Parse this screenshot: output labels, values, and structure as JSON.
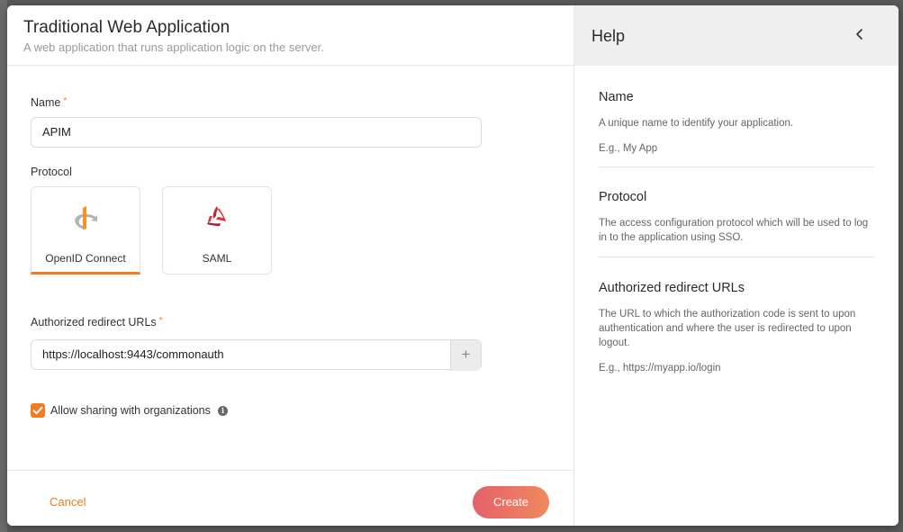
{
  "dialog": {
    "title": "Traditional Web Application",
    "subtitle": "A web application that runs application logic on the server."
  },
  "form": {
    "name_label": "Name",
    "required_marker": "*",
    "name_value": "APIM",
    "protocol_label": "Protocol",
    "protocols": [
      {
        "label": "OpenID Connect",
        "icon": "openid-icon",
        "selected": true
      },
      {
        "label": "SAML",
        "icon": "saml-icon",
        "selected": false
      }
    ],
    "redirect_label": "Authorized redirect URLs",
    "redirect_value": "https://localhost:9443/commonauth",
    "add_symbol": "+",
    "sharing_label": "Allow sharing with organizations",
    "sharing_checked": true,
    "info_symbol": "i"
  },
  "footer": {
    "cancel_label": "Cancel",
    "create_label": "Create"
  },
  "help": {
    "title": "Help",
    "back_symbol": "‹",
    "sections": [
      {
        "heading": "Name",
        "text": "A unique name to identify your application.",
        "example": "E.g., My App"
      },
      {
        "heading": "Protocol",
        "text": "The access configuration protocol which will be used to log in to the application using SSO."
      },
      {
        "heading": "Authorized redirect URLs",
        "text": "The URL to which the authorization code is sent to upon authentication and where the user is redirected to upon logout.",
        "example": "E.g., https://myapp.io/login"
      }
    ]
  },
  "colors": {
    "accent": "#f47b20",
    "create_gradient_start": "#e5606b",
    "create_gradient_end": "#f08a5d"
  }
}
